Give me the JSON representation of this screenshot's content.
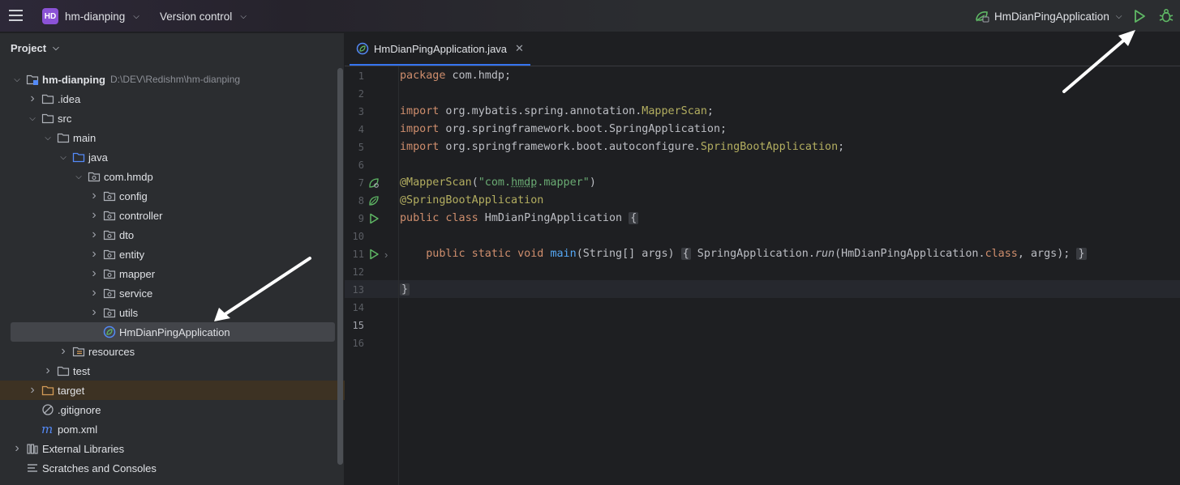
{
  "titlebar": {
    "project_badge": "HD",
    "project_name": "hm-dianping",
    "vcs_label": "Version control",
    "run_config": "HmDianPingApplication",
    "icons": [
      "menu-icon",
      "run-icon",
      "debug-icon"
    ]
  },
  "sidebar": {
    "title": "Project",
    "tree": [
      {
        "label": "hm-dianping",
        "path": "D:\\DEV\\Redishm\\hm-dianping",
        "level": 0,
        "expanded": true,
        "icon": "module-folder"
      },
      {
        "label": ".idea",
        "level": 1,
        "expanded": false,
        "icon": "folder"
      },
      {
        "label": "src",
        "level": 1,
        "expanded": true,
        "icon": "folder"
      },
      {
        "label": "main",
        "level": 2,
        "expanded": true,
        "icon": "folder"
      },
      {
        "label": "java",
        "level": 3,
        "expanded": true,
        "icon": "source-folder"
      },
      {
        "label": "com.hmdp",
        "level": 4,
        "expanded": true,
        "icon": "package"
      },
      {
        "label": "config",
        "level": 5,
        "expanded": false,
        "icon": "package"
      },
      {
        "label": "controller",
        "level": 5,
        "expanded": false,
        "icon": "package"
      },
      {
        "label": "dto",
        "level": 5,
        "expanded": false,
        "icon": "package"
      },
      {
        "label": "entity",
        "level": 5,
        "expanded": false,
        "icon": "package"
      },
      {
        "label": "mapper",
        "level": 5,
        "expanded": false,
        "icon": "package"
      },
      {
        "label": "service",
        "level": 5,
        "expanded": false,
        "icon": "package"
      },
      {
        "label": "utils",
        "level": 5,
        "expanded": false,
        "icon": "package"
      },
      {
        "label": "HmDianPingApplication",
        "level": 5,
        "icon": "spring-class",
        "selected": true
      },
      {
        "label": "resources",
        "level": 3,
        "expanded": false,
        "icon": "resources-folder"
      },
      {
        "label": "test",
        "level": 2,
        "expanded": false,
        "icon": "folder"
      },
      {
        "label": "target",
        "level": 1,
        "expanded": false,
        "icon": "excluded-folder"
      },
      {
        "label": ".gitignore",
        "level": 1,
        "icon": "ignore-file"
      },
      {
        "label": "pom.xml",
        "level": 1,
        "icon": "maven-file"
      },
      {
        "label": "External Libraries",
        "level": 0,
        "expanded": false,
        "icon": "libraries"
      },
      {
        "label": "Scratches and Consoles",
        "level": 0,
        "icon": "scratches"
      }
    ]
  },
  "editor": {
    "tab_label": "HmDianPingApplication.java",
    "line_numbers": [
      "1",
      "2",
      "3",
      "4",
      "5",
      "6",
      "7",
      "8",
      "9",
      "10",
      "11",
      "12",
      "13",
      "14",
      "15",
      "16"
    ],
    "current_line": "15",
    "code": {
      "l1_kw": "package",
      "l1_rest": " com.hmdp;",
      "l3_kw": "import",
      "l3_rest": " org.mybatis.spring.annotation.",
      "l3_cls": "MapperScan",
      "l3_end": ";",
      "l4_kw": "import",
      "l4_rest": " org.springframework.boot.SpringApplication;",
      "l5_kw": "import",
      "l5_rest": " org.springframework.boot.autoconfigure.",
      "l5_cls": "SpringBootApplication",
      "l5_end": ";",
      "l7_ann": "@MapperScan",
      "l7_p1": "(",
      "l7_s1": "\"com.",
      "l7_s2": "hmdp",
      "l7_s3": ".mapper\"",
      "l7_p2": ")",
      "l8_ann": "@SpringBootApplication",
      "l9_kw": "public class",
      "l9_rest": " HmDianPingApplication ",
      "l9_brace": "{",
      "l11_indent": "    ",
      "l11_kw": "public static void",
      "l11_sp": " ",
      "l11_fn": "main",
      "l11_params": "(String[] args) ",
      "l11_b1": "{",
      "l11_body1": " SpringApplication.",
      "l11_run": "run",
      "l11_body2": "(HmDianPingApplication.",
      "l11_cls": "class",
      "l11_body3": ", args); ",
      "l11_b2": "}",
      "l15": "}"
    }
  },
  "colors": {
    "accent": "#3574f0",
    "run_green": "#5fb865",
    "keyword": "#cf8e6d",
    "annotation": "#b3ae60",
    "string": "#6aab73",
    "function": "#56a8f5"
  }
}
